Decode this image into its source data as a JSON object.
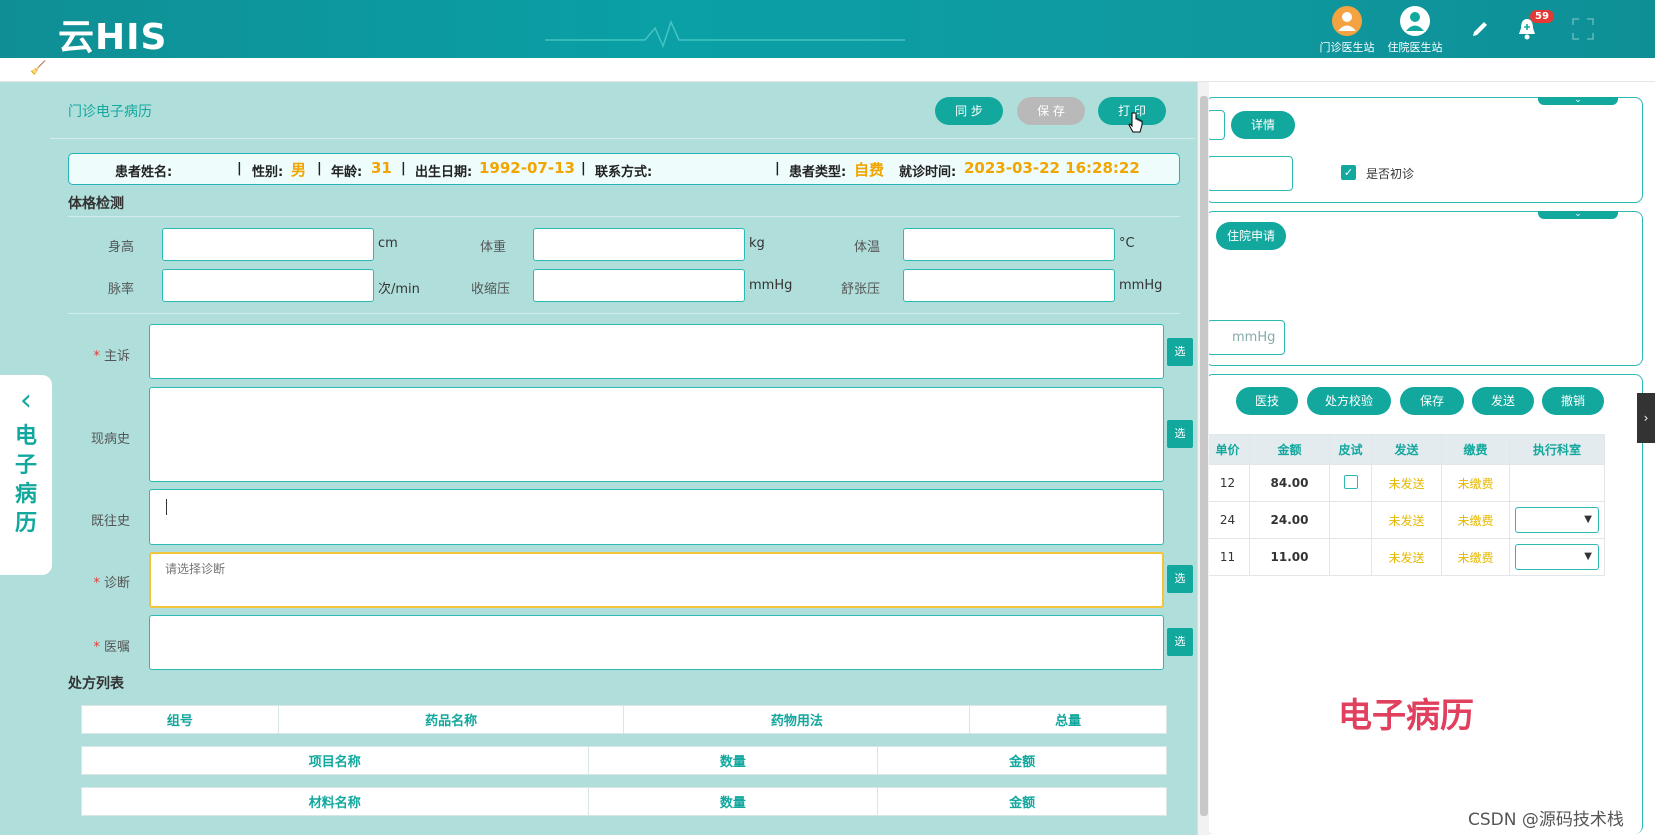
{
  "header": {
    "logo": "云HIS",
    "stations": [
      {
        "label": "门诊医生站",
        "icon": "outpatient-doctor-icon",
        "color": "#f4a340"
      },
      {
        "label": "住院医生站",
        "icon": "inpatient-doctor-icon",
        "color": "#ffffff"
      }
    ],
    "notification_count": "59"
  },
  "background_page": {
    "detail_btn": "详情",
    "first_visit_label": "是否初诊",
    "admission_btn": "住院申请",
    "mmhg_placeholder": "mmHg",
    "action_buttons": [
      "医技",
      "处方校验",
      "保存",
      "发送",
      "撤销"
    ],
    "table": {
      "headers": [
        "单价",
        "金额",
        "皮试",
        "发送",
        "缴费",
        "执行科室"
      ],
      "rows": [
        {
          "price": "12",
          "amount": "84.00",
          "send": "未发送",
          "pay": "未缴费"
        },
        {
          "price": "24",
          "amount": "24.00",
          "send": "未发送",
          "pay": "未缴费"
        },
        {
          "price": "11",
          "amount": "11.00",
          "send": "未发送",
          "pay": "未缴费"
        }
      ]
    },
    "watermark": "电子病历",
    "csdn": "CSDN @源码技术栈"
  },
  "drawer": {
    "tab_label": "电子病历",
    "title": "门诊电子病历",
    "buttons": {
      "sync": "同 步",
      "save": "保 存",
      "print": "打 印"
    },
    "patient": {
      "name_label": "患者姓名:",
      "gender_label": "性别:",
      "gender": "男",
      "age_label": "年龄:",
      "age": "31",
      "dob_label": "出生日期:",
      "dob": "1992-07-13",
      "contact_label": "联系方式:",
      "type_label": "患者类型:",
      "type": "自费",
      "visit_label": "就诊时间:",
      "visit_time": "2023-03-22 16:28:22",
      "sep": "|"
    },
    "exam_title": "体格检测",
    "vitals": {
      "height": "身高",
      "height_unit": "cm",
      "weight": "体重",
      "weight_unit": "kg",
      "temp": "体温",
      "temp_unit": "°C",
      "pulse": "脉率",
      "pulse_unit": "次/min",
      "systolic": "收缩压",
      "systolic_unit": "mmHg",
      "diastolic": "舒张压",
      "diastolic_unit": "mmHg"
    },
    "fields": {
      "chief": "主诉",
      "present": "现病史",
      "past": "既往史",
      "diagnosis": "诊断",
      "diagnosis_placeholder": "请选择诊断",
      "advice": "医嘱",
      "select_btn": "选",
      "required": "*"
    },
    "rx_title": "处方列表",
    "rx_table": [
      "组号",
      "药品名称",
      "药物用法",
      "总量"
    ],
    "item_table": [
      "项目名称",
      "数量",
      "金额"
    ],
    "material_table": [
      "材料名称",
      "数量",
      "金额"
    ]
  }
}
